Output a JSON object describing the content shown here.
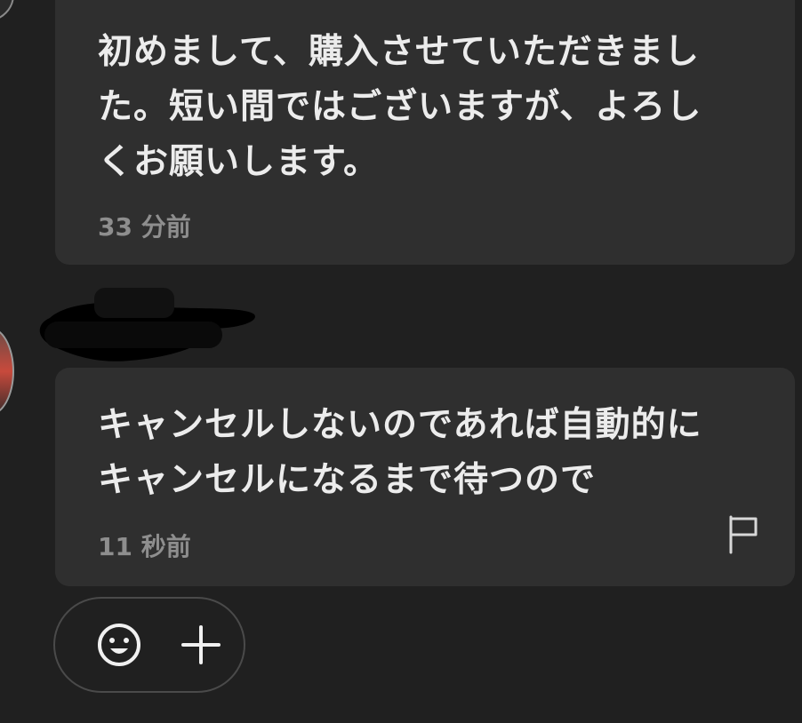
{
  "messages": [
    {
      "text": "初めまして、購入させていただきまし\nた。短い間ではございますが、よろし\nくお願いします。",
      "time": "33 分前"
    },
    {
      "text": "キャンセルしないのであれば自動的に\nキャンセルになるまで待つので",
      "time": "11 秒前"
    }
  ],
  "icons": {
    "report": "flag-icon",
    "emoji": "smiley-icon",
    "add": "plus-icon"
  },
  "colors": {
    "background": "#202020",
    "bubble": "#2f2f2f",
    "text": "#ececec",
    "muted": "#8e8e8e"
  }
}
